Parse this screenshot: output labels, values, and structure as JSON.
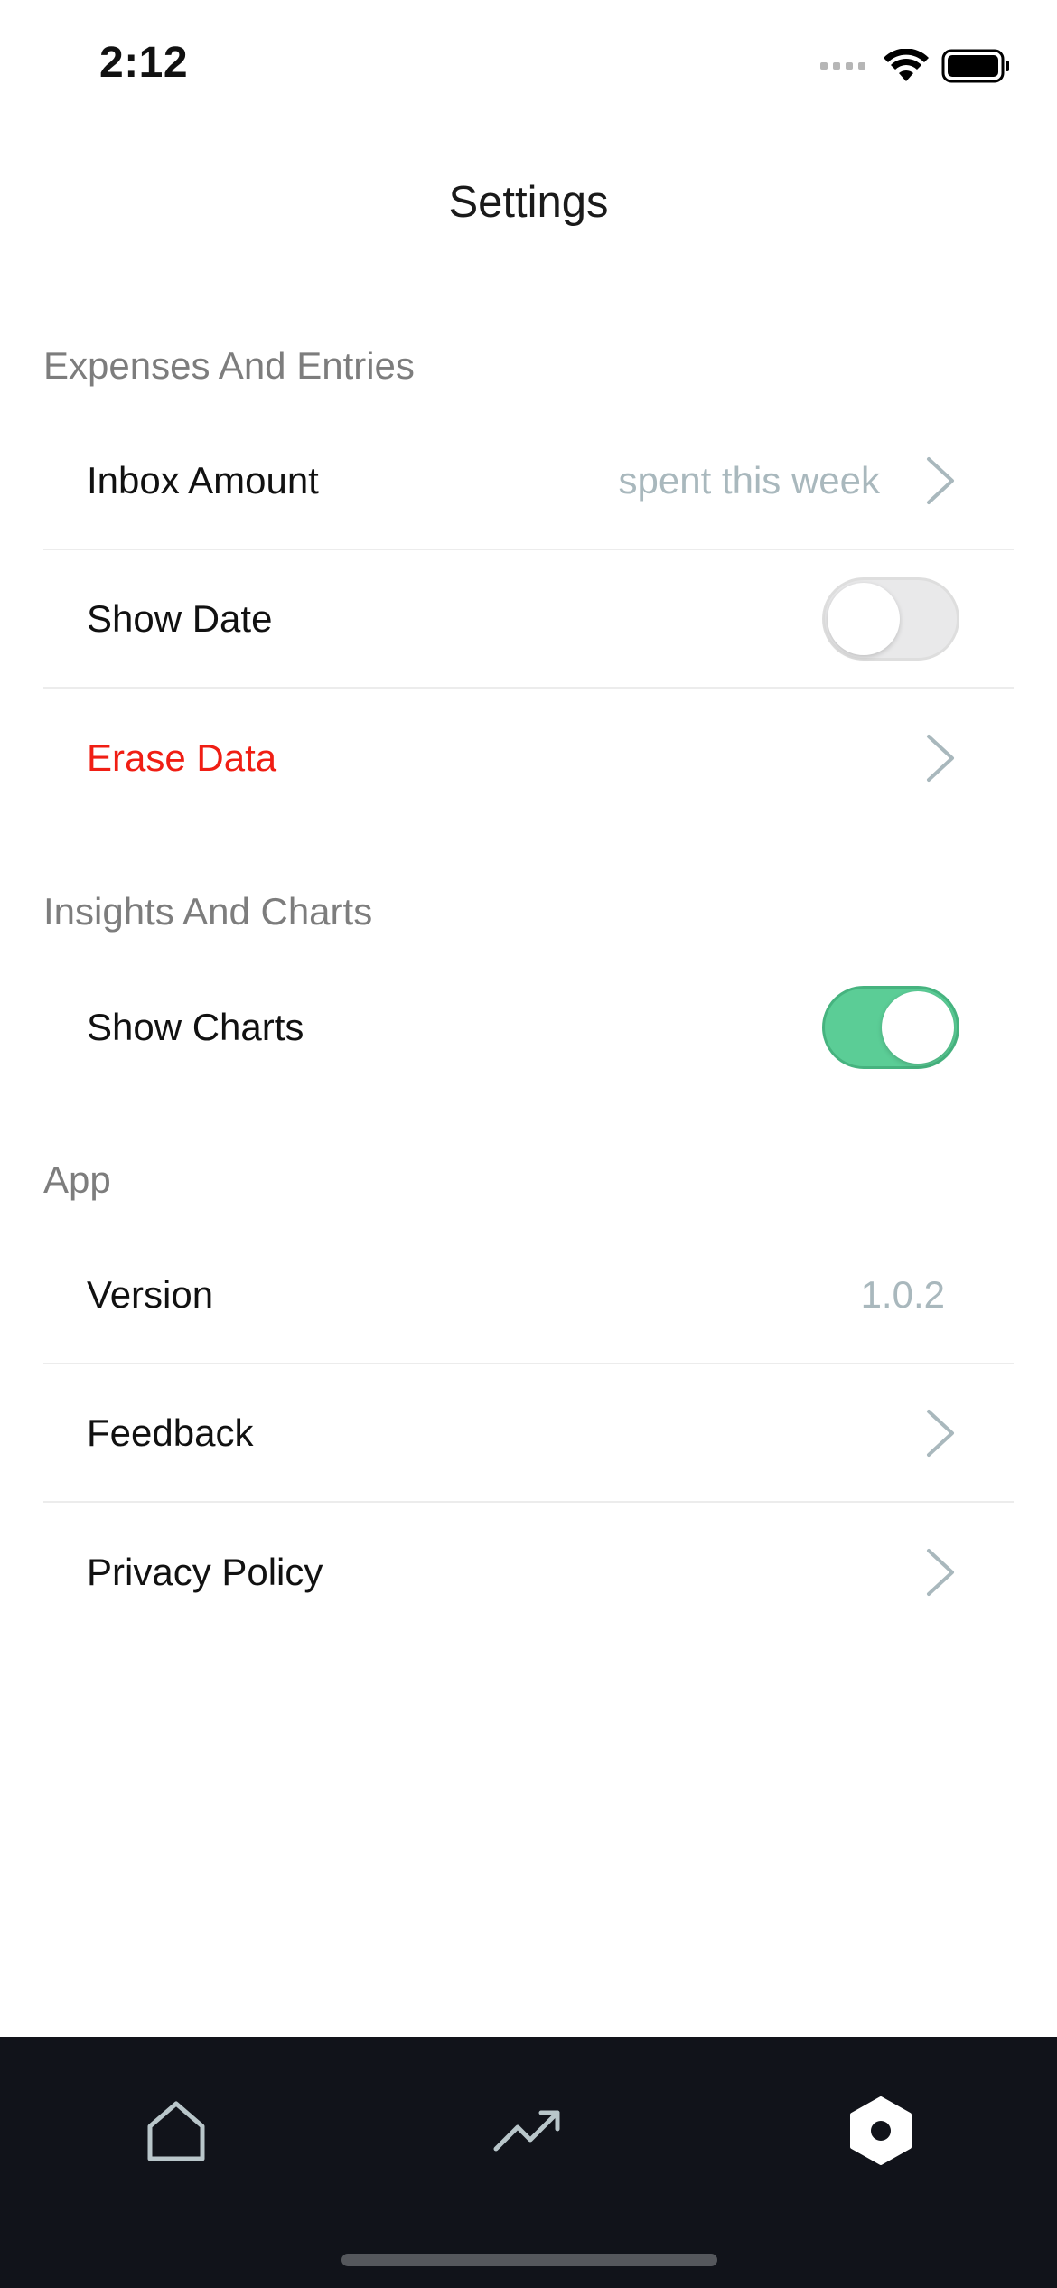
{
  "status_bar": {
    "time": "2:12"
  },
  "header": {
    "title": "Settings"
  },
  "sections": {
    "expenses": {
      "title": "Expenses And Entries",
      "inbox_amount": {
        "label": "Inbox Amount",
        "value": "spent this week"
      },
      "show_date": {
        "label": "Show Date",
        "enabled": false
      },
      "erase_data": {
        "label": "Erase Data"
      }
    },
    "insights": {
      "title": "Insights And Charts",
      "show_charts": {
        "label": "Show Charts",
        "enabled": true
      }
    },
    "app": {
      "title": "App",
      "version": {
        "label": "Version",
        "value": "1.0.2"
      },
      "feedback": {
        "label": "Feedback"
      },
      "privacy_policy": {
        "label": "Privacy Policy"
      }
    }
  },
  "tab_bar": {
    "tabs": [
      {
        "icon": "home-icon",
        "active": false
      },
      {
        "icon": "trending-up-icon",
        "active": false
      },
      {
        "icon": "settings-hexagon-icon",
        "active": true
      }
    ]
  },
  "colors": {
    "danger": "#f01e14",
    "toggle_on": "#5bcd96",
    "secondary_text": "#a9b8bd",
    "tab_bar_bg": "#11131a"
  }
}
